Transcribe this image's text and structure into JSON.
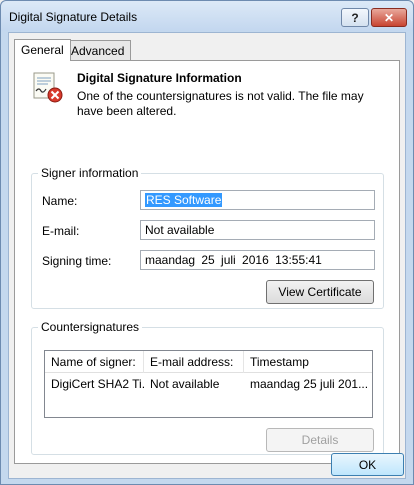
{
  "window": {
    "title": "Digital Signature Details",
    "help_label": "?",
    "close_label": "✕"
  },
  "tabs": [
    {
      "label": "General",
      "active": true
    },
    {
      "label": "Advanced",
      "active": false
    }
  ],
  "header": {
    "title": "Digital Signature Information",
    "message": "One of the countersignatures is not valid. The file may have been altered."
  },
  "signer": {
    "legend": "Signer information",
    "name_label": "Name:",
    "name_value": "RES Software",
    "email_label": "E-mail:",
    "email_value": "Not available",
    "time_label": "Signing time:",
    "time_value": "maandag 25 juli 2016 13:55:41",
    "view_cert_label": "View Certificate"
  },
  "countersignatures": {
    "legend": "Countersignatures",
    "columns": [
      "Name of signer:",
      "E-mail address:",
      "Timestamp"
    ],
    "rows": [
      [
        "DigiCert SHA2 Ti...",
        "Not available",
        "maandag 25 juli 201..."
      ]
    ],
    "details_label": "Details"
  },
  "footer": {
    "ok_label": "OK"
  }
}
